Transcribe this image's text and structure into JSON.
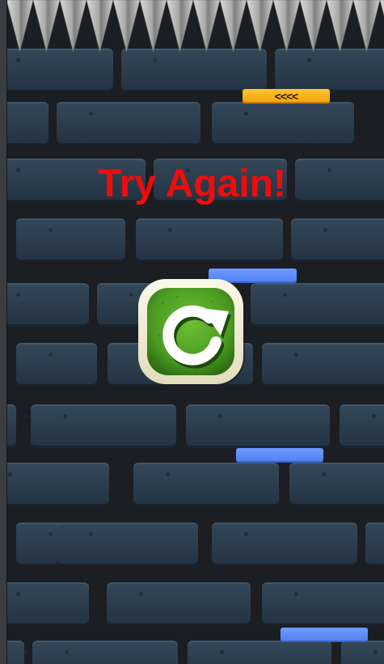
{
  "screen": {
    "message": "Try Again!",
    "retry_button": {
      "icon": "restart-arrow-icon"
    }
  },
  "scene": {
    "spikes_icon": "ceiling-spikes",
    "arrow_platform": {
      "label": "<<<<",
      "color": "#f5a60f"
    },
    "platform_color": "#5b8cf7",
    "platforms_count": 3
  },
  "colors": {
    "title": "#f10c0c",
    "retry_green": "#4a9a22",
    "retry_frame": "#f3efd9"
  }
}
